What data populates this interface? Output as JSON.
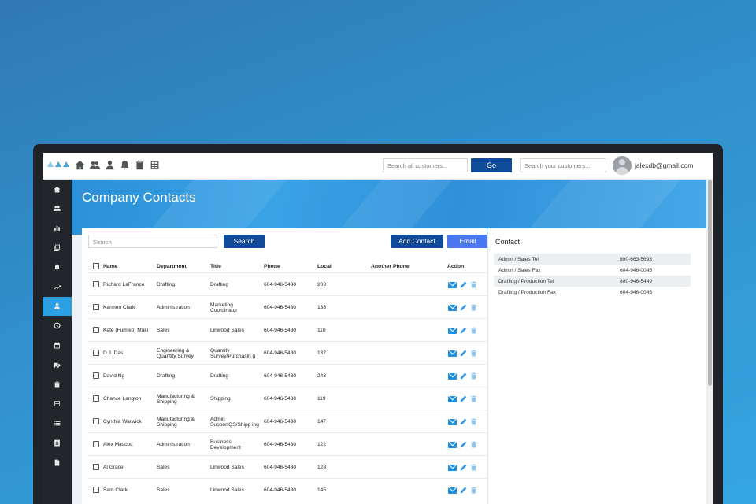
{
  "topbar": {
    "nav_icons": [
      "home-icon",
      "users-icon",
      "user-icon",
      "bell-icon",
      "clipboard-icon",
      "grid-icon"
    ],
    "search_all_placeholder": "Search all customers...",
    "go_label": "Go",
    "search_your_placeholder": "Search your customers...",
    "user_email": "jalexdb@gmail.com"
  },
  "sidebar": {
    "items": [
      "home-icon",
      "users-icon",
      "bar-chart-icon",
      "copy-icon",
      "bell-icon",
      "trending-icon",
      "user-icon",
      "clock-icon",
      "calendar-icon",
      "truck-icon",
      "clipboard-icon",
      "grid-icon",
      "list-icon",
      "contact-card-icon",
      "document-icon"
    ],
    "active_index": 6
  },
  "page": {
    "title": "Company Contacts"
  },
  "table": {
    "search_placeholder": "Search",
    "search_label": "Search",
    "add_contact_label": "Add Contact",
    "email_label": "Email",
    "columns": {
      "name": "Name",
      "department": "Department",
      "title": "Title",
      "phone": "Phone",
      "local": "Local",
      "another_phone": "Another Phone",
      "action": "Action"
    },
    "rows": [
      {
        "name": "Richard LaFrance",
        "department": "Drafting",
        "title": "Drafting",
        "phone": "604-946-5430",
        "local": "203",
        "another_phone": ""
      },
      {
        "name": "Karmen Clark",
        "department": "Administration",
        "title": "Marketing Coordinator",
        "phone": "604-946-5430",
        "local": "138",
        "another_phone": ""
      },
      {
        "name": "Kate (Fumiko) Maki",
        "department": "Sales",
        "title": "Linwood Sales",
        "phone": "604-946-5430",
        "local": "110",
        "another_phone": ""
      },
      {
        "name": "D.J. Das",
        "department": "Engineering & Quantity Survey",
        "title": "Quantity Survey/Purchasin g",
        "phone": "604-946-5430",
        "local": "137",
        "another_phone": ""
      },
      {
        "name": "David Ng",
        "department": "Drafting",
        "title": "Drafting",
        "phone": "604-946-5430",
        "local": "243",
        "another_phone": ""
      },
      {
        "name": "Chance Langton",
        "department": "Manufacturing & Shipping",
        "title": "Shipping",
        "phone": "604-946-5430",
        "local": "119",
        "another_phone": ""
      },
      {
        "name": "Cynthia Warwick",
        "department": "Manufacturing & Shipping",
        "title": "Admin SupportQS/Shipp ing",
        "phone": "604-946-5430",
        "local": "147",
        "another_phone": ""
      },
      {
        "name": "Alex Mascott",
        "department": "Administration",
        "title": "Business Development",
        "phone": "604-946-5430",
        "local": "122",
        "another_phone": ""
      },
      {
        "name": "Al Grace",
        "department": "Sales",
        "title": "Linwood Sales",
        "phone": "604-946-5430",
        "local": "128",
        "another_phone": ""
      },
      {
        "name": "Sam Clark",
        "department": "Sales",
        "title": "Linwood Sales",
        "phone": "604-946-5430",
        "local": "145",
        "another_phone": ""
      }
    ]
  },
  "contact_panel": {
    "title": "Contact",
    "rows": [
      {
        "label": "Admin / Sales Tel",
        "value": "800-663-5693"
      },
      {
        "label": "Admin / Sales Fax",
        "value": "604-946-0045"
      },
      {
        "label": "Drafting / Production Tel",
        "value": "800-946-5449"
      },
      {
        "label": "Drafting / Production Fax",
        "value": "604-946-0045"
      }
    ]
  },
  "colors": {
    "accent": "#0f4b99",
    "email_button": "#4a78f0",
    "sidebar_bg": "#22262a",
    "sidebar_active": "#2ba1e3",
    "banner": "#2f90d9"
  }
}
